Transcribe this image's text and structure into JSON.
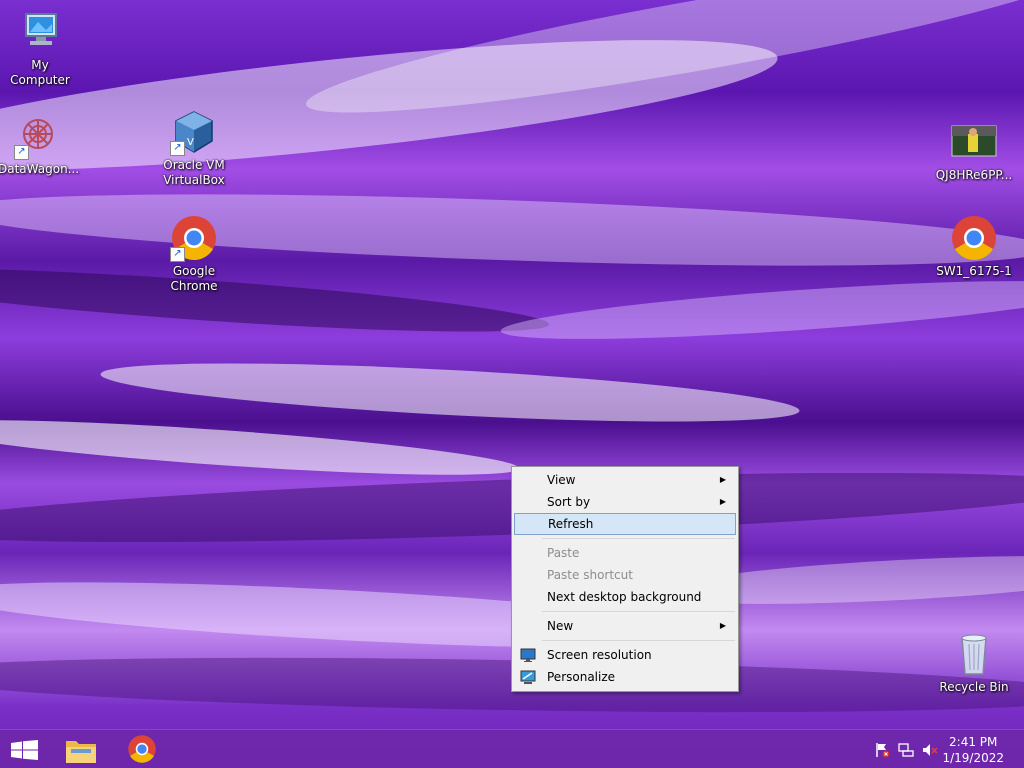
{
  "desktop": {
    "icons": [
      {
        "label": "My Computer",
        "icon": "computer-icon"
      },
      {
        "label": "DataWagon...",
        "icon": "datawagon-icon"
      },
      {
        "label": "Oracle VM VirtualBox",
        "icon": "virtualbox-icon"
      },
      {
        "label": "Google Chrome",
        "icon": "chrome-icon"
      },
      {
        "label": "QJ8HRe6PP...",
        "icon": "image-file-icon"
      },
      {
        "label": "SW1_6175-1",
        "icon": "chrome-icon"
      },
      {
        "label": "Recycle Bin",
        "icon": "recycle-bin-icon"
      }
    ]
  },
  "context_menu": {
    "items": [
      {
        "label": "View",
        "submenu": true,
        "enabled": true
      },
      {
        "label": "Sort by",
        "submenu": true,
        "enabled": true
      },
      {
        "label": "Refresh",
        "submenu": false,
        "enabled": true,
        "highlighted": true
      },
      {
        "label": "Paste",
        "submenu": false,
        "enabled": false
      },
      {
        "label": "Paste shortcut",
        "submenu": false,
        "enabled": false
      },
      {
        "label": "Next desktop background",
        "submenu": false,
        "enabled": true
      },
      {
        "label": "New",
        "submenu": true,
        "enabled": true
      },
      {
        "label": "Screen resolution",
        "submenu": false,
        "enabled": true,
        "icon": "display-icon"
      },
      {
        "label": "Personalize",
        "submenu": false,
        "enabled": true,
        "icon": "personalize-icon"
      }
    ]
  },
  "taskbar": {
    "pinned": [
      "start-icon",
      "file-explorer-icon",
      "chrome-icon"
    ],
    "tray": [
      "action-center-flag-icon",
      "network-icon",
      "volume-muted-icon"
    ],
    "clock": {
      "time": "2:41 PM",
      "date": "1/19/2022"
    }
  },
  "colors": {
    "accent": "#6e28aa",
    "menu_highlight": "#d5e6f7"
  }
}
